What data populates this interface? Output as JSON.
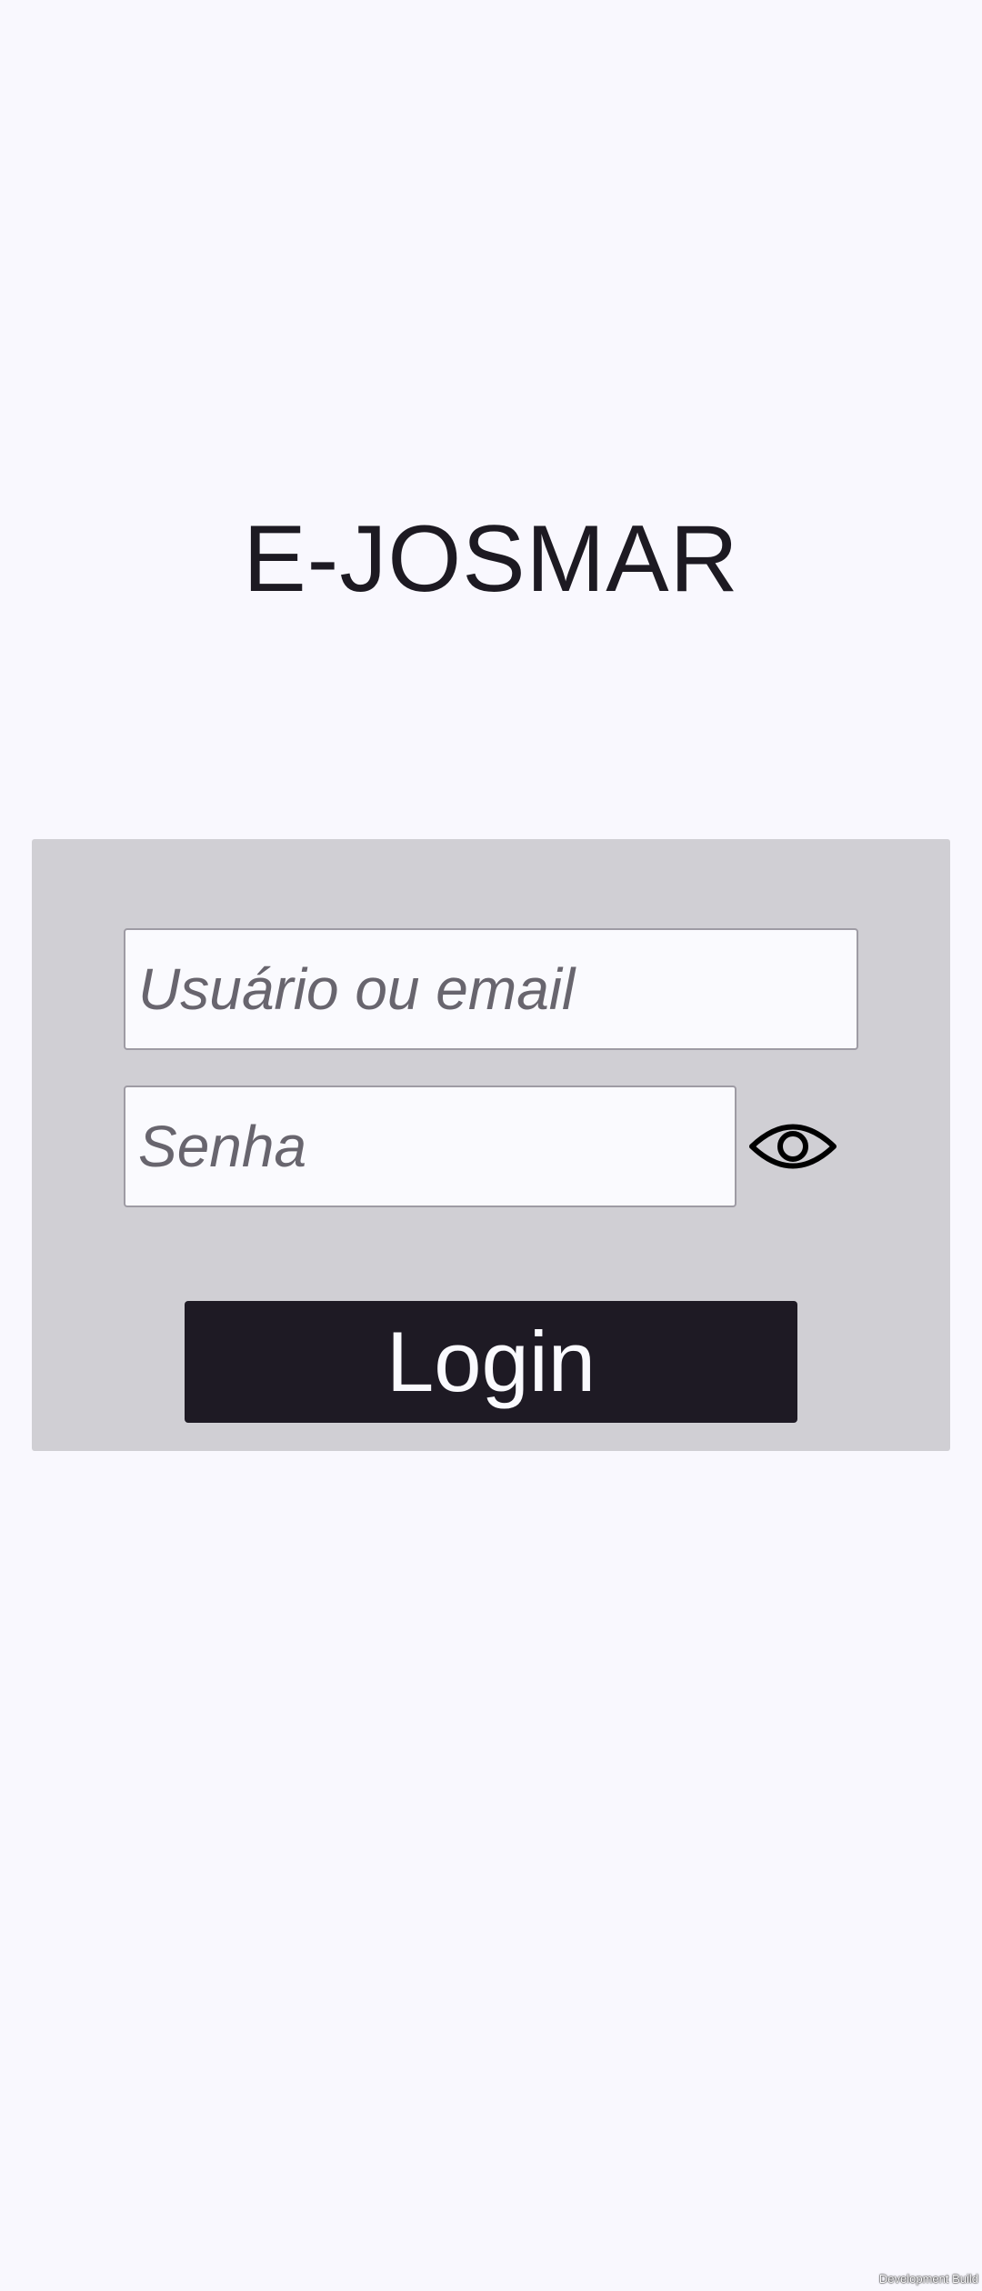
{
  "app": {
    "title": "E-JOSMAR"
  },
  "login_form": {
    "username_placeholder": "Usuário ou email",
    "username_value": "",
    "password_placeholder": "Senha",
    "password_value": "",
    "show_password_icon": "eye-icon",
    "submit_label": "Login"
  },
  "footer": {
    "build_label": "Development Build"
  },
  "colors": {
    "background": "#f9f8fe",
    "panel": "#d0cfd4",
    "button": "#1e1a24",
    "button_text": "#fafafe",
    "title_text": "#1d1a22"
  }
}
